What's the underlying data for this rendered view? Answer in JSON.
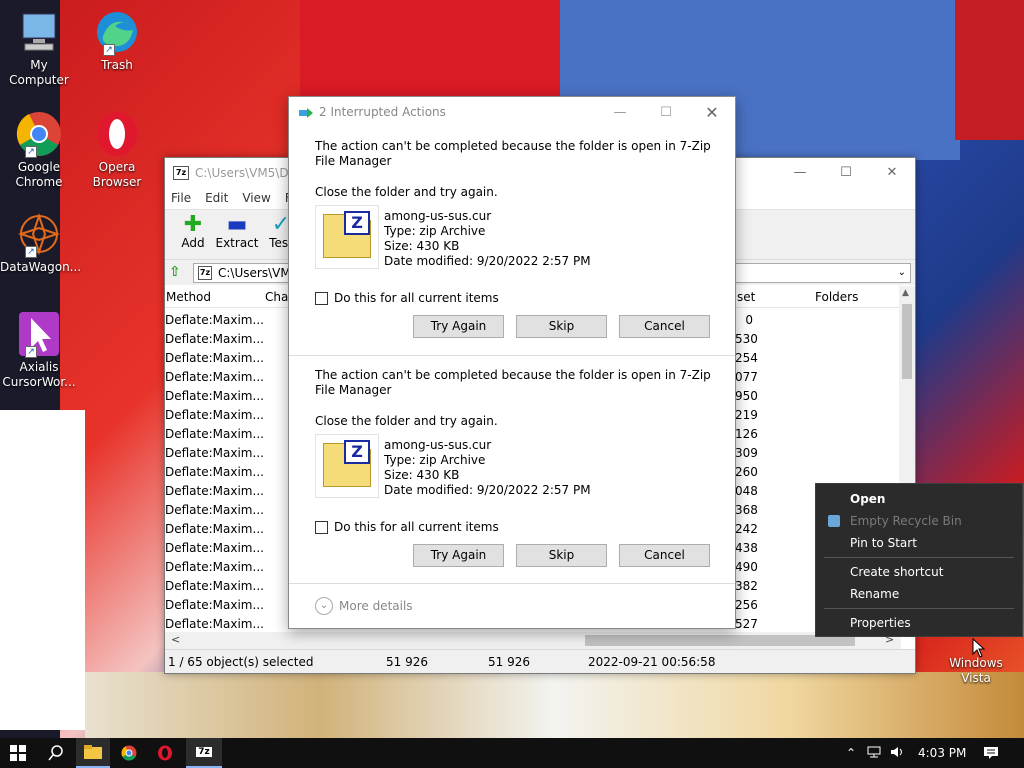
{
  "desktop": {
    "icons": [
      {
        "label": "My Computer"
      },
      {
        "label": "Trash"
      },
      {
        "label_l1": "Google",
        "label_l2": "Chrome"
      },
      {
        "label_l1": "Opera",
        "label_l2": "Browser"
      },
      {
        "label": "DataWagon..."
      },
      {
        "label_l1": "Axialis",
        "label_l2": "CursorWor..."
      }
    ],
    "recycle_l1": "Windows",
    "recycle_l2": "Vista"
  },
  "zip_window": {
    "title": "C:\\Users\\VM5\\Do",
    "menu": [
      "File",
      "Edit",
      "View",
      "Fa"
    ],
    "toolbar": [
      {
        "label": "Add",
        "icon": "plus-icon",
        "color": "#22aa22"
      },
      {
        "label": "Extract",
        "icon": "minus-icon",
        "color": "#1a3ac0"
      },
      {
        "label": "Test",
        "icon": "check-icon",
        "color": "#1aa0c0"
      }
    ],
    "address": "C:\\Users\\VM",
    "columns": {
      "method": "Method",
      "char": "Char",
      "offset": "set",
      "folders": "Folders"
    },
    "rows": [
      {
        "method": "Deflate:Maxim...",
        "offset": "0"
      },
      {
        "method": "Deflate:Maxim...",
        "offset": "530"
      },
      {
        "method": "Deflate:Maxim...",
        "offset": "254"
      },
      {
        "method": "Deflate:Maxim...",
        "offset": "077"
      },
      {
        "method": "Deflate:Maxim...",
        "offset": "950"
      },
      {
        "method": "Deflate:Maxim...",
        "offset": "219"
      },
      {
        "method": "Deflate:Maxim...",
        "offset": "126"
      },
      {
        "method": "Deflate:Maxim...",
        "offset": "309"
      },
      {
        "method": "Deflate:Maxim...",
        "offset": "260"
      },
      {
        "method": "Deflate:Maxim...",
        "offset": "048"
      },
      {
        "method": "Deflate:Maxim...",
        "offset": "368"
      },
      {
        "method": "Deflate:Maxim...",
        "offset": "242"
      },
      {
        "method": "Deflate:Maxim...",
        "offset": "438"
      },
      {
        "method": "Deflate:Maxim...",
        "offset": "490"
      },
      {
        "method": "Deflate:Maxim...",
        "offset": "382"
      },
      {
        "method": "Deflate:Maxim...",
        "offset": "256"
      },
      {
        "method": "Deflate:Maxim...",
        "offset": "527"
      }
    ],
    "status": {
      "selected": "1 / 65 object(s) selected",
      "size": "51 926",
      "packed": "51 926",
      "modified": "2022-09-21 00:56:58"
    }
  },
  "dialog": {
    "title": "2 Interrupted Actions",
    "items": [
      {
        "message": "The action can't be completed because the folder is open in 7-Zip File Manager",
        "hint": "Close the folder and try again.",
        "file_name": "among-us-sus.cur",
        "file_type": "Type: zip Archive",
        "file_size": "Size: 430 KB",
        "file_date": "Date modified: 9/20/2022 2:57 PM",
        "checkbox": "Do this for all current items",
        "try_again": "Try Again",
        "skip": "Skip",
        "cancel": "Cancel"
      },
      {
        "message": "The action can't be completed because the folder is open in 7-Zip File Manager",
        "hint": "Close the folder and try again.",
        "file_name": "among-us-sus.cur",
        "file_type": "Type: zip Archive",
        "file_size": "Size: 430 KB",
        "file_date": "Date modified: 9/20/2022 2:57 PM",
        "checkbox": "Do this for all current items",
        "try_again": "Try Again",
        "skip": "Skip",
        "cancel": "Cancel"
      }
    ],
    "more_details": "More details"
  },
  "context_menu": {
    "open": "Open",
    "empty": "Empty Recycle Bin",
    "pin": "Pin to Start",
    "shortcut": "Create shortcut",
    "rename": "Rename",
    "properties": "Properties"
  },
  "taskbar": {
    "time": "4:03 PM"
  }
}
